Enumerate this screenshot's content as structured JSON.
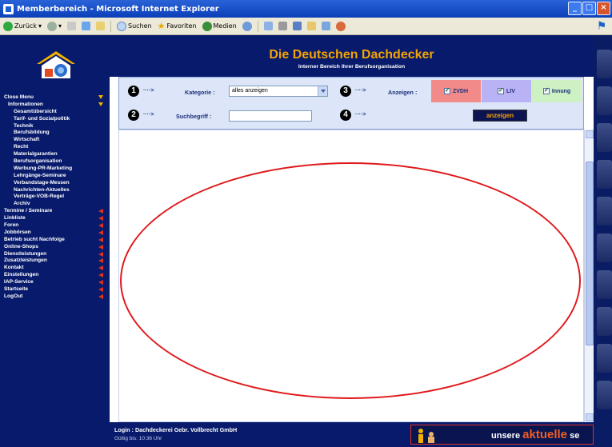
{
  "window": {
    "title": "Memberbereich - Microsoft Internet Explorer"
  },
  "toolbar": {
    "back_label": "Zurück",
    "search_label": "Suchen",
    "favorites_label": "Favoriten",
    "media_label": "Medien"
  },
  "header": {
    "title": "Die Deutschen Dachdecker",
    "subtitle": "Interner Bereich Ihrer Berufsorganisation"
  },
  "sidebar": {
    "items": [
      {
        "label": "Close Menu",
        "level": 0,
        "marker": "down"
      },
      {
        "label": "Informationen",
        "level": 1,
        "marker": "down"
      },
      {
        "label": "Gesamtübersicht",
        "level": 2,
        "marker": ""
      },
      {
        "label": "Tarif- und Sozialpolitik",
        "level": 2,
        "marker": ""
      },
      {
        "label": "Technik",
        "level": 2,
        "marker": ""
      },
      {
        "label": "Berufsbildung",
        "level": 2,
        "marker": ""
      },
      {
        "label": "Wirtschaft",
        "level": 2,
        "marker": ""
      },
      {
        "label": "Recht",
        "level": 2,
        "marker": ""
      },
      {
        "label": "Materialgarantien",
        "level": 2,
        "marker": ""
      },
      {
        "label": "Berufsorganisation",
        "level": 2,
        "marker": ""
      },
      {
        "label": "Werbung-PR-Marketing",
        "level": 2,
        "marker": ""
      },
      {
        "label": "Lehrgänge-Seminare",
        "level": 2,
        "marker": ""
      },
      {
        "label": "Verbandstage-Messen",
        "level": 2,
        "marker": ""
      },
      {
        "label": "Nachrichten-Aktuelles",
        "level": 2,
        "marker": ""
      },
      {
        "label": "Verträge-VOB-Regel",
        "level": 2,
        "marker": ""
      },
      {
        "label": "Archiv",
        "level": 2,
        "marker": ""
      },
      {
        "label": "Termine / Seminare",
        "level": 0,
        "marker": "left"
      },
      {
        "label": "Linkliste",
        "level": 0,
        "marker": "left"
      },
      {
        "label": "Foren",
        "level": 0,
        "marker": "left"
      },
      {
        "label": "Jobbörsen",
        "level": 0,
        "marker": "left"
      },
      {
        "label": "Betrieb sucht Nachfolge",
        "level": 0,
        "marker": "left"
      },
      {
        "label": "Online-Shops",
        "level": 0,
        "marker": "left"
      },
      {
        "label": "Dienstleistungen",
        "level": 0,
        "marker": "left"
      },
      {
        "label": "Zusatzleistungen",
        "level": 0,
        "marker": "left"
      },
      {
        "label": "Kontakt",
        "level": 0,
        "marker": "left"
      },
      {
        "label": "Einstellungen",
        "level": 0,
        "marker": "left"
      },
      {
        "label": "IAP-Service",
        "level": 0,
        "marker": "left"
      },
      {
        "label": "Startseite",
        "level": 0,
        "marker": "left"
      },
      {
        "label": "LogOut",
        "level": 0,
        "marker": "left"
      }
    ]
  },
  "filter": {
    "step1": "1",
    "step2": "2",
    "step3": "3",
    "step4": "4",
    "arrow": "····>",
    "category_label": "Kategorie :",
    "category_value": "alles anzeigen",
    "search_label": "Suchbegriff :",
    "search_value": "",
    "display_label": "Anzeigen :",
    "chip_zvdh": "ZVDH",
    "chip_liv": "LIV",
    "chip_innung": "Innung",
    "show_button": "anzeigen"
  },
  "footer": {
    "login": "Login : Dachdeckerei Gebr. Vollbrecht GmbH",
    "valid": "Gültig bis: 10:36 Uhr",
    "ticker_prefix": "unsere",
    "ticker_accent": "aktuelle",
    "ticker_suffix": "se"
  },
  "colors": {
    "navy": "#071a6b",
    "orange": "#f5a300",
    "annotation_red": "#e0191c",
    "chip_zvdh": "#f28a8a",
    "chip_liv": "#b9b2f4",
    "chip_innung": "#cdf1c3"
  }
}
